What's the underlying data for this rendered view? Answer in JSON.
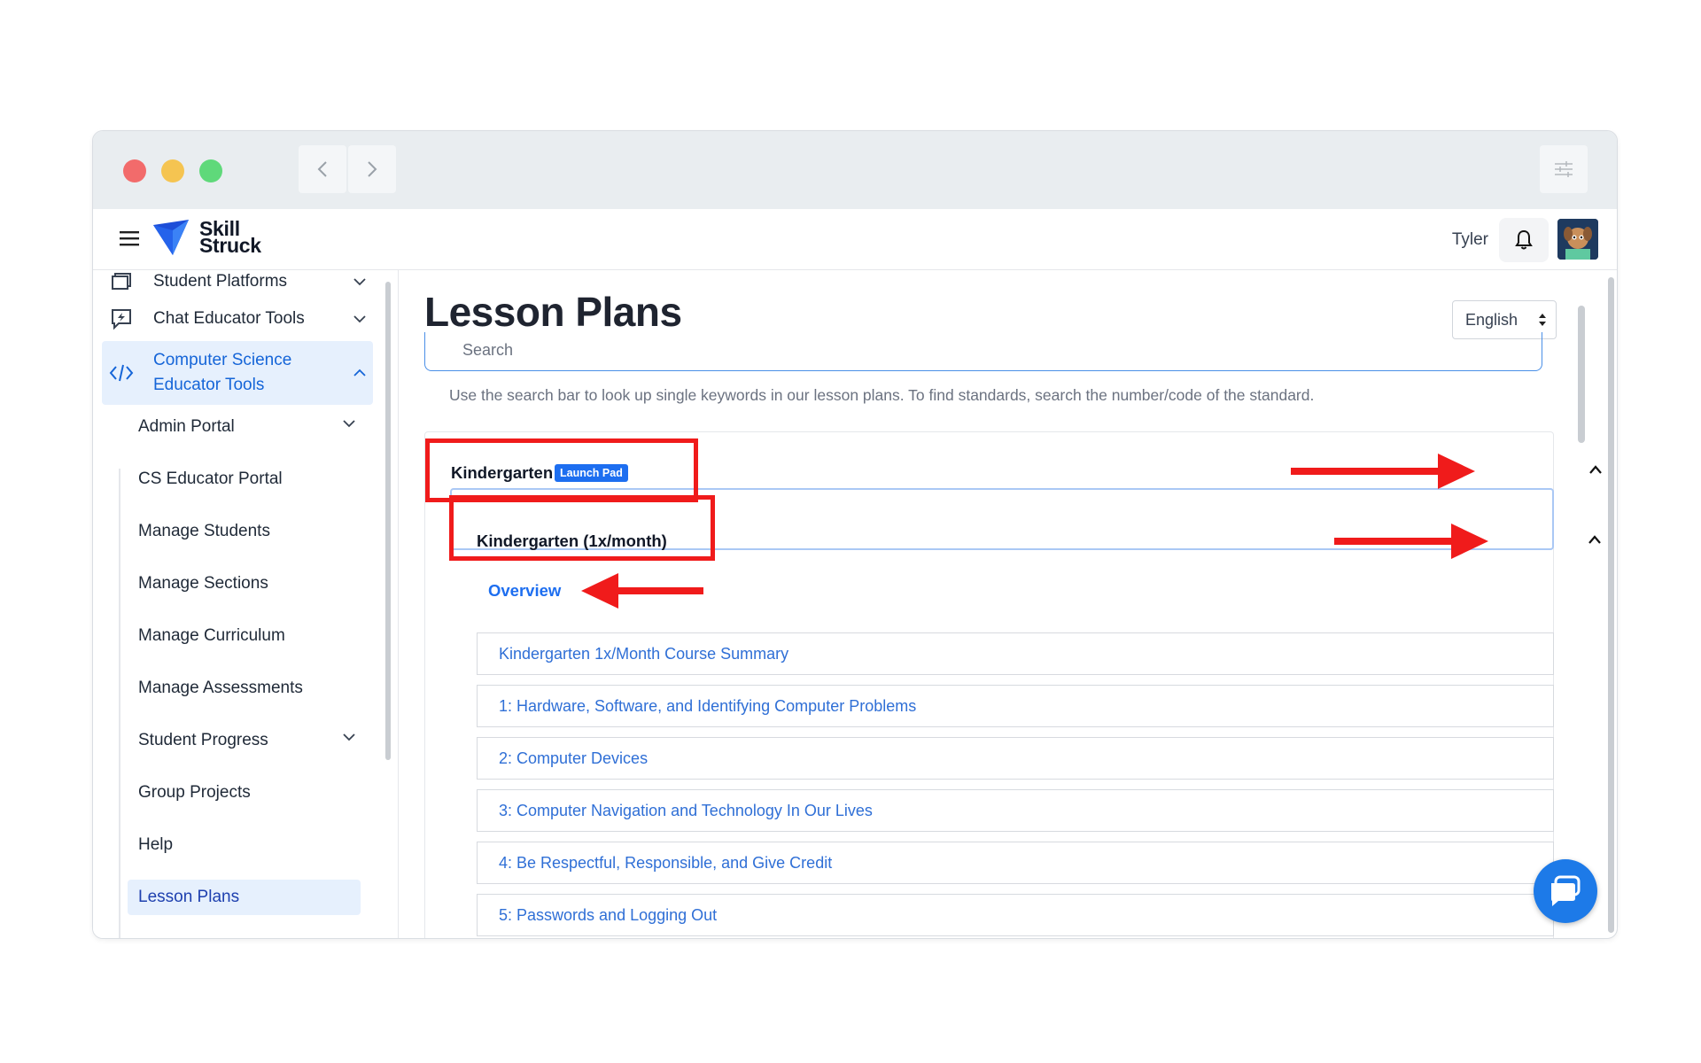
{
  "browser": {
    "traffic_lights": [
      "close",
      "minimize",
      "maximize"
    ],
    "back_icon": "chevron-left-icon",
    "forward_icon": "chevron-right-icon",
    "settings_icon": "sliders-icon"
  },
  "header": {
    "logo_line1": "Skill",
    "logo_line2": "Struck",
    "user_name": "Tyler",
    "bell_icon": "bell-icon"
  },
  "sidebar": {
    "items": [
      {
        "label": "Student Platforms",
        "icon": "windows-icon",
        "expanded": false
      },
      {
        "label": "Chat Educator Tools",
        "icon": "chat-bolt-icon",
        "expanded": false
      },
      {
        "label_line1": "Computer Science",
        "label_line2": "Educator Tools",
        "icon": "code-icon",
        "expanded": true
      }
    ],
    "subitems": [
      {
        "label": "Admin Portal",
        "has_chevron": true
      },
      {
        "label": "CS Educator Portal"
      },
      {
        "label": "Manage Students"
      },
      {
        "label": "Manage Sections"
      },
      {
        "label": "Manage Curriculum"
      },
      {
        "label": "Manage Assessments"
      },
      {
        "label": "Student Progress",
        "has_chevron": true
      },
      {
        "label": "Group Projects"
      },
      {
        "label": "Help"
      },
      {
        "label": "Lesson Plans",
        "active": true
      }
    ]
  },
  "main": {
    "title": "Lesson Plans",
    "language": "English",
    "search_placeholder": "Search",
    "hint": "Use the search bar to look up single keywords in our lesson plans. To find standards, search the number/code of the standard.",
    "grade": {
      "title": "Kindergarten",
      "badge": "Launch Pad",
      "sub": {
        "title": "Kindergarten (1x/month)",
        "overview": "Overview",
        "lessons": [
          "Kindergarten 1x/Month Course Summary",
          "1: Hardware, Software, and Identifying Computer Problems",
          "2: Computer Devices",
          "3: Computer Navigation and Technology In Our Lives",
          "4: Be Respectful, Responsible, and Give Credit",
          "5: Passwords and Logging Out"
        ]
      }
    }
  },
  "colors": {
    "accent": "#1d6ef0",
    "annotation": "#f01b1b",
    "active_bg": "#e6f0fd"
  }
}
